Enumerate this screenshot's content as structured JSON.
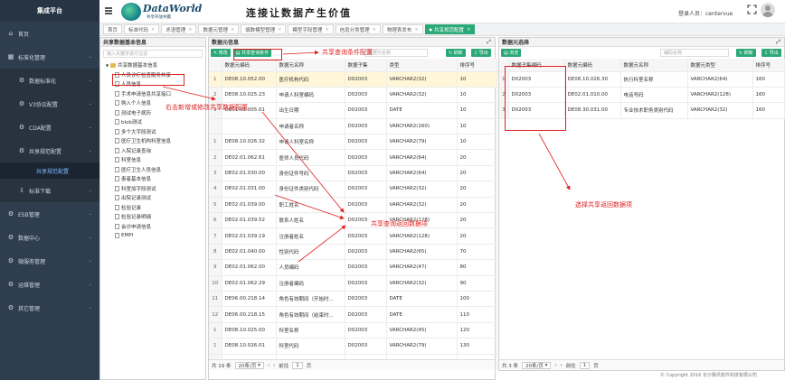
{
  "sidebar": {
    "title": "集成平台",
    "items": [
      {
        "label": "首页",
        "icon": "home-icon"
      },
      {
        "label": "标准化管理",
        "icon": "grid-icon",
        "expandable": true
      },
      {
        "label": "数据标准化",
        "icon": "gear-icon",
        "expandable": true,
        "sub": true
      },
      {
        "label": "V3协议配置",
        "icon": "gear-icon",
        "expandable": true,
        "sub": true
      },
      {
        "label": "CDA配置",
        "icon": "gear-icon",
        "expandable": true,
        "sub": true
      },
      {
        "label": "共享规范配置",
        "icon": "gear-icon",
        "expandable": true,
        "sub": true
      },
      {
        "label": "共享规范配置",
        "icon": "",
        "sub2": true,
        "active": true
      },
      {
        "label": "标准下载",
        "icon": "download-icon",
        "expandable": true,
        "sub": true
      },
      {
        "label": "ESB管理",
        "icon": "gear-icon",
        "expandable": true
      },
      {
        "label": "数据中心",
        "icon": "gear-icon",
        "expandable": true
      },
      {
        "label": "微服务管理",
        "icon": "gear-icon",
        "expandable": true
      },
      {
        "label": "运维管理",
        "icon": "gear-icon",
        "expandable": true
      },
      {
        "label": "其它管理",
        "icon": "gear-icon",
        "expandable": true
      }
    ]
  },
  "header": {
    "logo_text": "DataWorld",
    "logo_sub": "共享开放共赢",
    "slogan": "连接让数据产生价值",
    "user_label": "登录人员：centervue"
  },
  "tabs": [
    {
      "label": "首页",
      "active": false,
      "closable": false
    },
    {
      "label": "标准代码",
      "active": false,
      "closable": true
    },
    {
      "label": "术语管理",
      "active": false,
      "closable": true
    },
    {
      "label": "数据元管理",
      "active": false,
      "closable": true
    },
    {
      "label": "填数模型管理",
      "active": false,
      "closable": true
    },
    {
      "label": "模型字段管理",
      "active": false,
      "closable": true
    },
    {
      "label": "信息分类管理",
      "active": false,
      "closable": true
    },
    {
      "label": "物理表发布",
      "active": false,
      "closable": true
    },
    {
      "label": "共享规范配置",
      "active": true,
      "closable": true
    }
  ],
  "left_panel": {
    "title": "共享数据基本信息",
    "search_placeholder": "输入关键字进行过滤",
    "root": "共享数据基本信息",
    "nodes": [
      "人员诊疗检查服务共享",
      "人员信息",
      "手术申请信息共享接口",
      "购入个人信息",
      "测试电子病历",
      "blob测试",
      "多个大字段测试",
      "医疗卫生机构科室信息",
      "入院记录查询",
      "科室信息",
      "医疗卫生人员信息",
      "患者基本信息",
      "科室加字段测试",
      "出院记录测试",
      "检验记录",
      "检验记录明细",
      "会诊申请信息",
      "EMPI"
    ]
  },
  "mid_panel": {
    "title": "数据元信息",
    "btn_edit": "修改",
    "btn_share": "共享查询条件",
    "search_placeholder": "数据元名称",
    "btn_refresh": "刷新",
    "btn_export": "导出",
    "headers": [
      "",
      "数据元编码",
      "数据元名称",
      "数据子集",
      "类型",
      "排序号"
    ],
    "rows": [
      [
        "1",
        "DE08.10.052.00",
        "医疗机构代码",
        "D02003",
        "VARCHAR2(32)",
        "10"
      ],
      [
        "2",
        "DE08.10.025.23",
        "申请人科室编码",
        "D02003",
        "VARCHAR2(32)",
        "10"
      ],
      [
        "3",
        "DE01.01.005.01",
        "出生日期",
        "D02003",
        "DATE",
        "10"
      ],
      [
        "",
        "",
        "申请者名称",
        "D02003",
        "VARCHAR2(160)",
        "10"
      ],
      [
        "1",
        "DE08.10.026.32",
        "申请人科室名称",
        "D02003",
        "VARCHAR2(79)",
        "10"
      ],
      [
        "2",
        "DE02.01.062.61",
        "医师人员代码",
        "D02003",
        "VARCHAR2(64)",
        "20"
      ],
      [
        "3",
        "DE02.01.030.00",
        "身份证件号码",
        "D02003",
        "VARCHAR2(64)",
        "20"
      ],
      [
        "4",
        "DE02.01.031.00",
        "身份证件类别代码",
        "D02003",
        "VARCHAR2(32)",
        "20"
      ],
      [
        "5",
        "DE02.01.039.00",
        "职工姓名",
        "D02003",
        "VARCHAR2(32)",
        "20"
      ],
      [
        "6",
        "DE02.01.039.52",
        "联系人姓名",
        "D02003",
        "VARCHAR2(128)",
        "20"
      ],
      [
        "7",
        "DE02.01.039.19",
        "注册者姓名",
        "D02003",
        "VARCHAR2(128)",
        "20"
      ],
      [
        "8",
        "DE02.01.040.00",
        "性别代码",
        "D02003",
        "VARCHAR2(65)",
        "70"
      ],
      [
        "9",
        "DE02.01.062.00",
        "人员编码",
        "D02003",
        "VARCHAR2(47)",
        "80"
      ],
      [
        "10",
        "DE02.01.062.29",
        "注册者编码",
        "D02003",
        "VARCHAR2(32)",
        "90"
      ],
      [
        "11",
        "DE06.00.218.14",
        "角色有效期间（开始时...",
        "D02003",
        "DATE",
        "100"
      ],
      [
        "12",
        "DE06.00.218.15",
        "角色有效期间（结束时...",
        "D02003",
        "DATE",
        "110"
      ],
      [
        "1",
        "DE08.10.025.00",
        "科室名称",
        "D02003",
        "VARCHAR2(45)",
        "120"
      ],
      [
        "1",
        "DE08.10.026.01",
        "科室代码",
        "D02003",
        "VARCHAR2(79)",
        "130"
      ],
      [
        "1",
        "DE08.10.026.00",
        "科室名称",
        "D02003",
        "VARCHAR2(128)",
        "140"
      ]
    ],
    "total": "共 19 条",
    "per_page": "20条/页",
    "goto_label": "前往",
    "page": "1",
    "page_unit": "页"
  },
  "right_panel": {
    "title": "数据元选择",
    "btn_browse": "浏览",
    "search_placeholder": "编码名称",
    "btn_refresh": "刷新",
    "btn_export": "导出",
    "headers": [
      "",
      "数据子集编码",
      "数据元编码",
      "数据元名称",
      "数据元类型",
      "排序号"
    ],
    "rows": [
      [
        "1",
        "D02003",
        "DE08.10.026.30",
        "执行科室名称",
        "VARCHAR2(64)",
        "160"
      ],
      [
        "2",
        "D02003",
        "DE02.01.010.00",
        "电话号码",
        "VARCHAR2(128)",
        "160"
      ],
      [
        "3",
        "D02003",
        "DE08.30.031.00",
        "专业技术职务类别代码",
        "VARCHAR2(32)",
        "160"
      ]
    ],
    "total": "共 3 条",
    "per_page": "20条/页",
    "goto_label": "前往",
    "page": "1",
    "page_unit": "页"
  },
  "annotations": {
    "share_condition": "共享查询条件配置",
    "right_click": "右击新增或修改共享数据配置",
    "share_return": "共享查询返回数据项",
    "select_return": "选择共享返回数据项"
  },
  "footer": "© Copyright 2016 长沙赛讯软件科技有限公司",
  "colors": {
    "sidebar": "#2f3e4e",
    "accent": "#2aa876",
    "annotation": "#e02020"
  }
}
